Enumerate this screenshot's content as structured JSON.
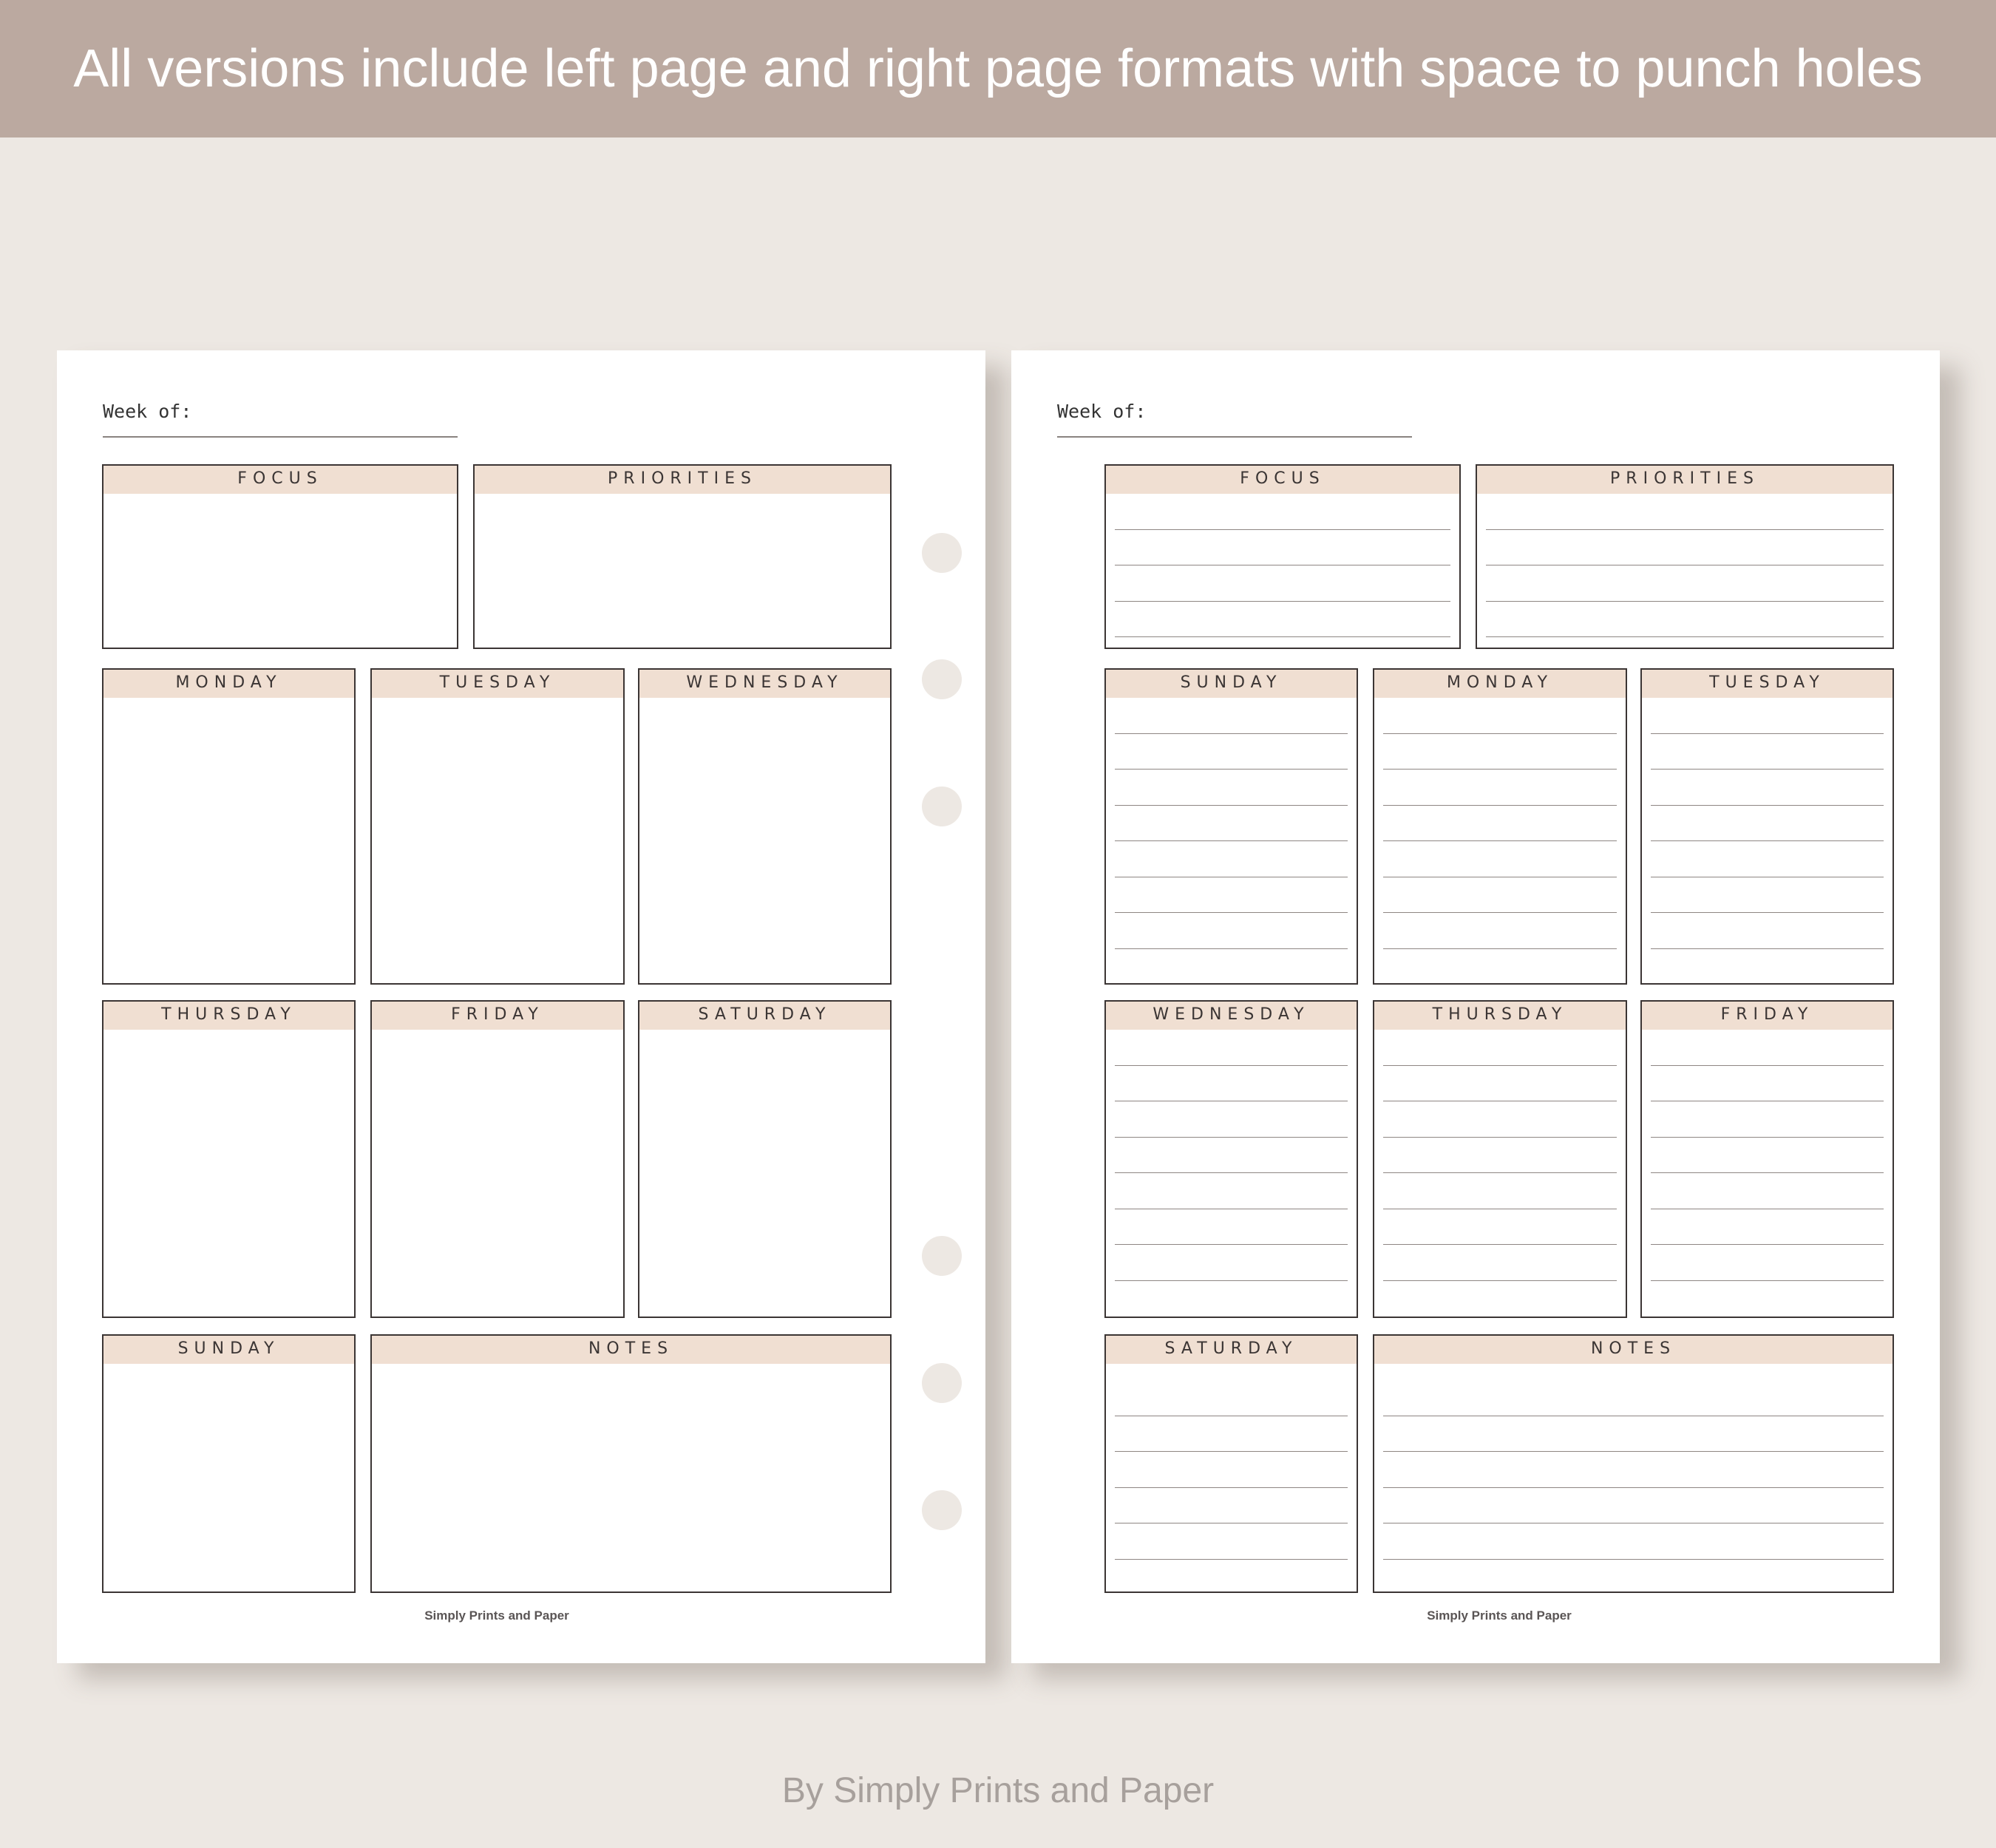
{
  "banner": {
    "text": "All versions include left page and right page formats with space to punch holes"
  },
  "left_page": {
    "week_label": "Week of:",
    "focus": "FOCUS",
    "priorities": "PRIORITIES",
    "row1": [
      "MONDAY",
      "TUESDAY",
      "WEDNESDAY"
    ],
    "row2": [
      "THURSDAY",
      "FRIDAY",
      "SATURDAY"
    ],
    "sunday": "SUNDAY",
    "notes": "NOTES",
    "footer": "Simply Prints and Paper"
  },
  "right_page": {
    "week_label": "Week of:",
    "focus": "FOCUS",
    "priorities": "PRIORITIES",
    "row1": [
      "SUNDAY",
      "MONDAY",
      "TUESDAY"
    ],
    "row2": [
      "WEDNESDAY",
      "THURSDAY",
      "FRIDAY"
    ],
    "saturday": "SATURDAY",
    "notes": "NOTES",
    "footer": "Simply Prints and Paper"
  },
  "credit": "By Simply Prints and Paper"
}
